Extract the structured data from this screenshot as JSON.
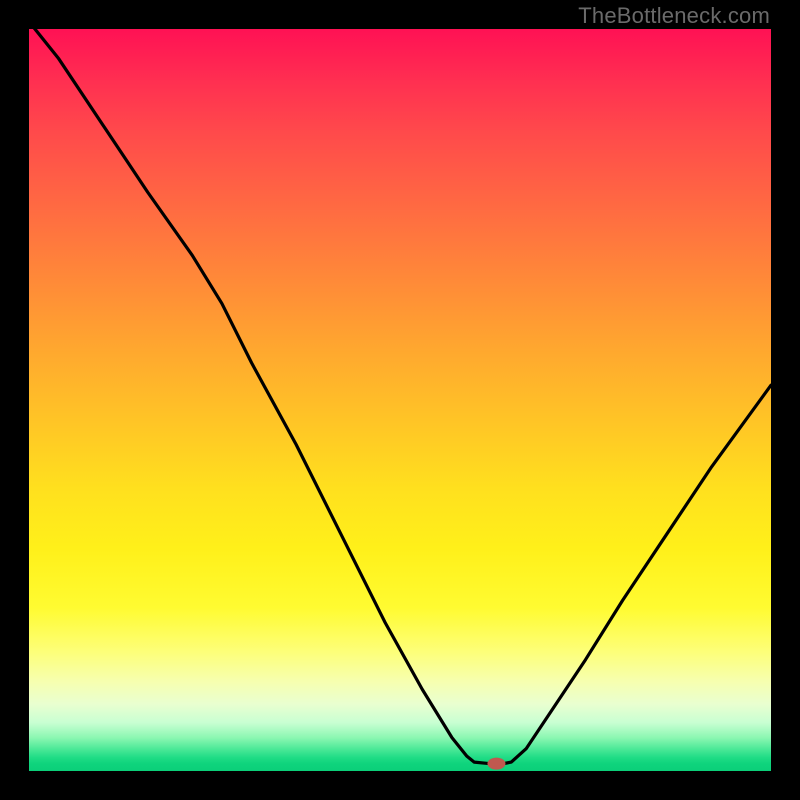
{
  "watermark": "TheBottleneck.com",
  "chart_data": {
    "type": "line",
    "title": "",
    "xlabel": "",
    "ylabel": "",
    "xlim": [
      0,
      100
    ],
    "ylim": [
      0,
      100
    ],
    "note": "No axis ticks or numeric labels are visible; x/y values are visual estimates on a 0–100 plot-area scale. y=100 at top, y=0 at bottom. The curve dips from top-left to a near-zero minimum around x≈63 then rises toward the right.",
    "series": [
      {
        "name": "curve",
        "points": [
          {
            "x": 0,
            "y": 101
          },
          {
            "x": 4,
            "y": 96
          },
          {
            "x": 10,
            "y": 87
          },
          {
            "x": 16,
            "y": 78
          },
          {
            "x": 22,
            "y": 69.5
          },
          {
            "x": 26,
            "y": 63
          },
          {
            "x": 30,
            "y": 55
          },
          {
            "x": 36,
            "y": 44
          },
          {
            "x": 42,
            "y": 32
          },
          {
            "x": 48,
            "y": 20
          },
          {
            "x": 53,
            "y": 11
          },
          {
            "x": 57,
            "y": 4.5
          },
          {
            "x": 59,
            "y": 2
          },
          {
            "x": 60,
            "y": 1.2
          },
          {
            "x": 62,
            "y": 1.0
          },
          {
            "x": 64,
            "y": 1.0
          },
          {
            "x": 65,
            "y": 1.2
          },
          {
            "x": 67,
            "y": 3
          },
          {
            "x": 70,
            "y": 7.5
          },
          {
            "x": 75,
            "y": 15
          },
          {
            "x": 80,
            "y": 23
          },
          {
            "x": 86,
            "y": 32
          },
          {
            "x": 92,
            "y": 41
          },
          {
            "x": 100,
            "y": 52
          }
        ]
      }
    ],
    "marker": {
      "x": 63,
      "y": 1.0,
      "color": "#c0584f"
    }
  }
}
